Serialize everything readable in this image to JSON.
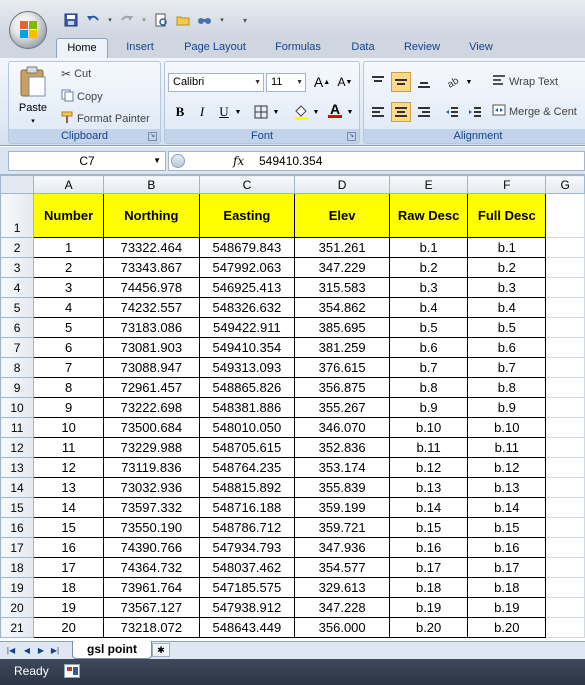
{
  "quick_access": {
    "icons": [
      "save-icon",
      "undo-icon",
      "redo-icon",
      "print-preview-icon",
      "open-icon",
      "find-icon",
      "customize-icon"
    ]
  },
  "tabs": [
    "Home",
    "Insert",
    "Page Layout",
    "Formulas",
    "Data",
    "Review",
    "View"
  ],
  "active_tab": "Home",
  "ribbon": {
    "clipboard": {
      "label": "Clipboard",
      "paste": "Paste",
      "cut": "Cut",
      "copy": "Copy",
      "format_painter": "Format Painter"
    },
    "font": {
      "label": "Font",
      "font_name": "Calibri",
      "font_size": "11",
      "bold": "B",
      "italic": "I",
      "underline": "U",
      "grow_font": "A",
      "shrink_font": "A",
      "font_color": "A"
    },
    "alignment": {
      "label": "Alignment",
      "wrap_text": "Wrap Text",
      "merge_center": "Merge & Cent"
    }
  },
  "formula_bar": {
    "name_box": "C7",
    "fx_label": "fx",
    "value": "549410.354"
  },
  "sheet": {
    "column_headers": [
      "A",
      "B",
      "C",
      "D",
      "E",
      "F",
      "G"
    ],
    "header_row_number": "1",
    "header_cells": [
      "Number",
      "Northing",
      "Easting",
      "Elev",
      "Raw Desc",
      "Full Desc"
    ],
    "rows": [
      {
        "row": "2",
        "cells": [
          "1",
          "73322.464",
          "548679.843",
          "351.261",
          "b.1",
          "b.1"
        ]
      },
      {
        "row": "3",
        "cells": [
          "2",
          "73343.867",
          "547992.063",
          "347.229",
          "b.2",
          "b.2"
        ]
      },
      {
        "row": "4",
        "cells": [
          "3",
          "74456.978",
          "546925.413",
          "315.583",
          "b.3",
          "b.3"
        ]
      },
      {
        "row": "5",
        "cells": [
          "4",
          "74232.557",
          "548326.632",
          "354.862",
          "b.4",
          "b.4"
        ]
      },
      {
        "row": "6",
        "cells": [
          "5",
          "73183.086",
          "549422.911",
          "385.695",
          "b.5",
          "b.5"
        ]
      },
      {
        "row": "7",
        "cells": [
          "6",
          "73081.903",
          "549410.354",
          "381.259",
          "b.6",
          "b.6"
        ]
      },
      {
        "row": "8",
        "cells": [
          "7",
          "73088.947",
          "549313.093",
          "376.615",
          "b.7",
          "b.7"
        ]
      },
      {
        "row": "9",
        "cells": [
          "8",
          "72961.457",
          "548865.826",
          "356.875",
          "b.8",
          "b.8"
        ]
      },
      {
        "row": "10",
        "cells": [
          "9",
          "73222.698",
          "548381.886",
          "355.267",
          "b.9",
          "b.9"
        ]
      },
      {
        "row": "11",
        "cells": [
          "10",
          "73500.684",
          "548010.050",
          "346.070",
          "b.10",
          "b.10"
        ]
      },
      {
        "row": "12",
        "cells": [
          "11",
          "73229.988",
          "548705.615",
          "352.836",
          "b.11",
          "b.11"
        ]
      },
      {
        "row": "13",
        "cells": [
          "12",
          "73119.836",
          "548764.235",
          "353.174",
          "b.12",
          "b.12"
        ]
      },
      {
        "row": "14",
        "cells": [
          "13",
          "73032.936",
          "548815.892",
          "355.839",
          "b.13",
          "b.13"
        ]
      },
      {
        "row": "15",
        "cells": [
          "14",
          "73597.332",
          "548716.188",
          "359.199",
          "b.14",
          "b.14"
        ]
      },
      {
        "row": "16",
        "cells": [
          "15",
          "73550.190",
          "548786.712",
          "359.721",
          "b.15",
          "b.15"
        ]
      },
      {
        "row": "17",
        "cells": [
          "16",
          "74390.766",
          "547934.793",
          "347.936",
          "b.16",
          "b.16"
        ]
      },
      {
        "row": "18",
        "cells": [
          "17",
          "74364.732",
          "548037.462",
          "354.577",
          "b.17",
          "b.17"
        ]
      },
      {
        "row": "19",
        "cells": [
          "18",
          "73961.764",
          "547185.575",
          "329.613",
          "b.18",
          "b.18"
        ]
      },
      {
        "row": "20",
        "cells": [
          "19",
          "73567.127",
          "547938.912",
          "347.228",
          "b.19",
          "b.19"
        ]
      },
      {
        "row": "21",
        "cells": [
          "20",
          "73218.072",
          "548643.449",
          "356.000",
          "b.20",
          "b.20"
        ]
      }
    ]
  },
  "sheet_tab": "gsl point",
  "status": "Ready",
  "colors": {
    "header_fill": "#ffff00",
    "ribbon_label": "#15428b",
    "status_bar": "#2a3444"
  }
}
